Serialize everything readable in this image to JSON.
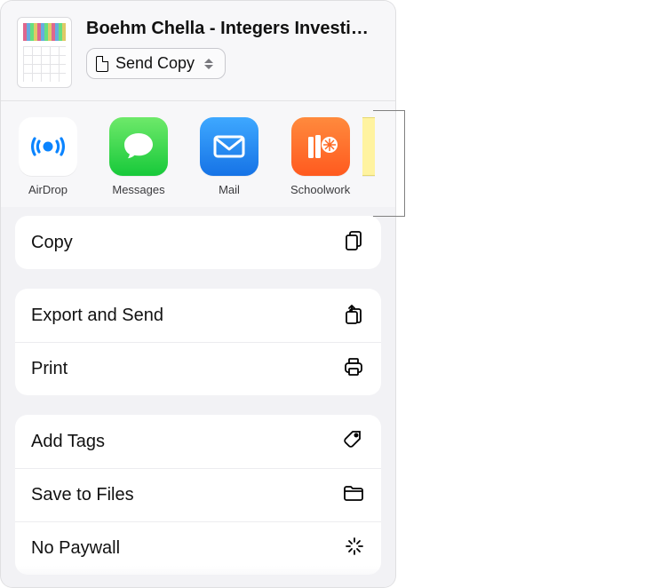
{
  "header": {
    "title": "Boehm Chella - Integers Investigati...",
    "picker_label": "Send Copy"
  },
  "apps": [
    {
      "key": "airdrop",
      "label": "AirDrop"
    },
    {
      "key": "messages",
      "label": "Messages"
    },
    {
      "key": "mail",
      "label": "Mail"
    },
    {
      "key": "schoolwork",
      "label": "Schoolwork"
    }
  ],
  "actions": {
    "copy": "Copy",
    "export_send": "Export and Send",
    "print": "Print",
    "add_tags": "Add Tags",
    "save_files": "Save to Files",
    "no_paywall": "No Paywall"
  }
}
